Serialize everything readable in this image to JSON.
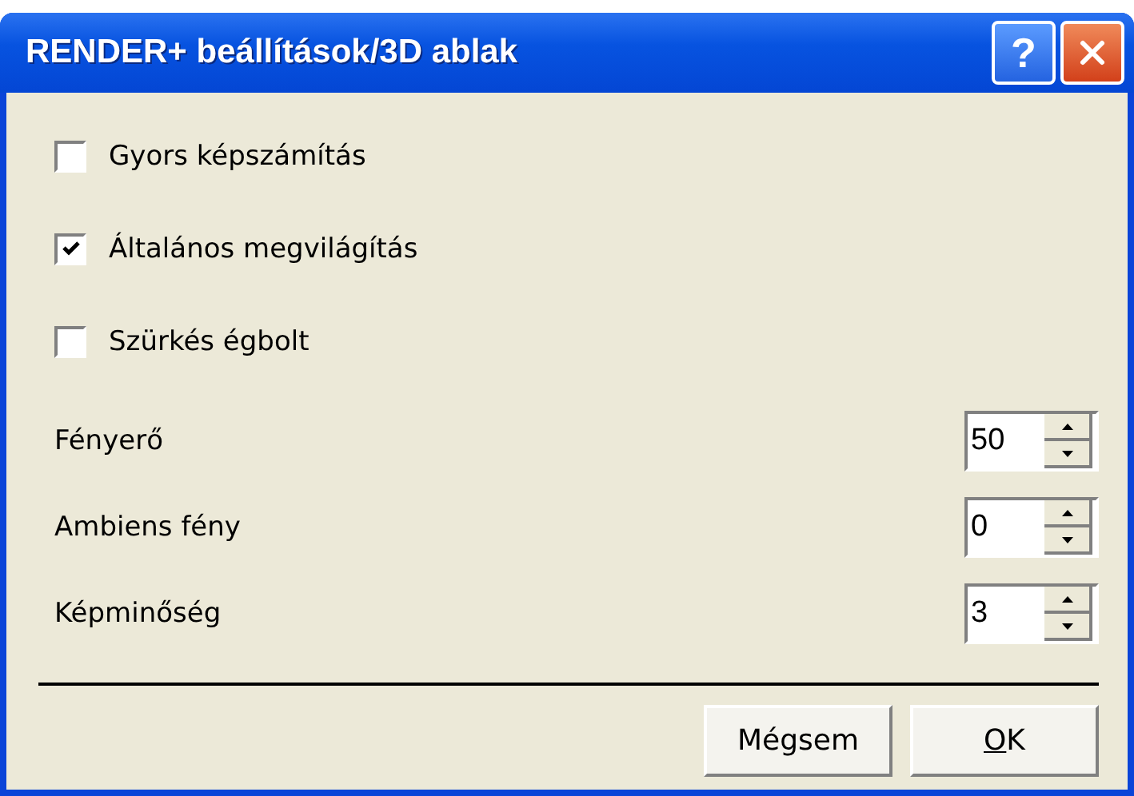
{
  "window": {
    "title": "RENDER+ beállítások/3D ablak",
    "title_buttons": [
      {
        "kind": "help",
        "label": "?"
      },
      {
        "kind": "close"
      }
    ]
  },
  "checkboxes": [
    {
      "label": "Gyors képszámítás",
      "checked": false
    },
    {
      "label": "Általános megvilágítás",
      "checked": true
    },
    {
      "label": "Szürkés égbolt",
      "checked": false
    }
  ],
  "spinners": [
    {
      "label": "Fényerő",
      "value": "50"
    },
    {
      "label": "Ambiens fény",
      "value": "0"
    },
    {
      "label": "Képminőség",
      "value": "3"
    }
  ],
  "buttons": [
    {
      "label": "Mégsem"
    },
    {
      "label": "OK",
      "first_letter_underlined": true
    }
  ]
}
